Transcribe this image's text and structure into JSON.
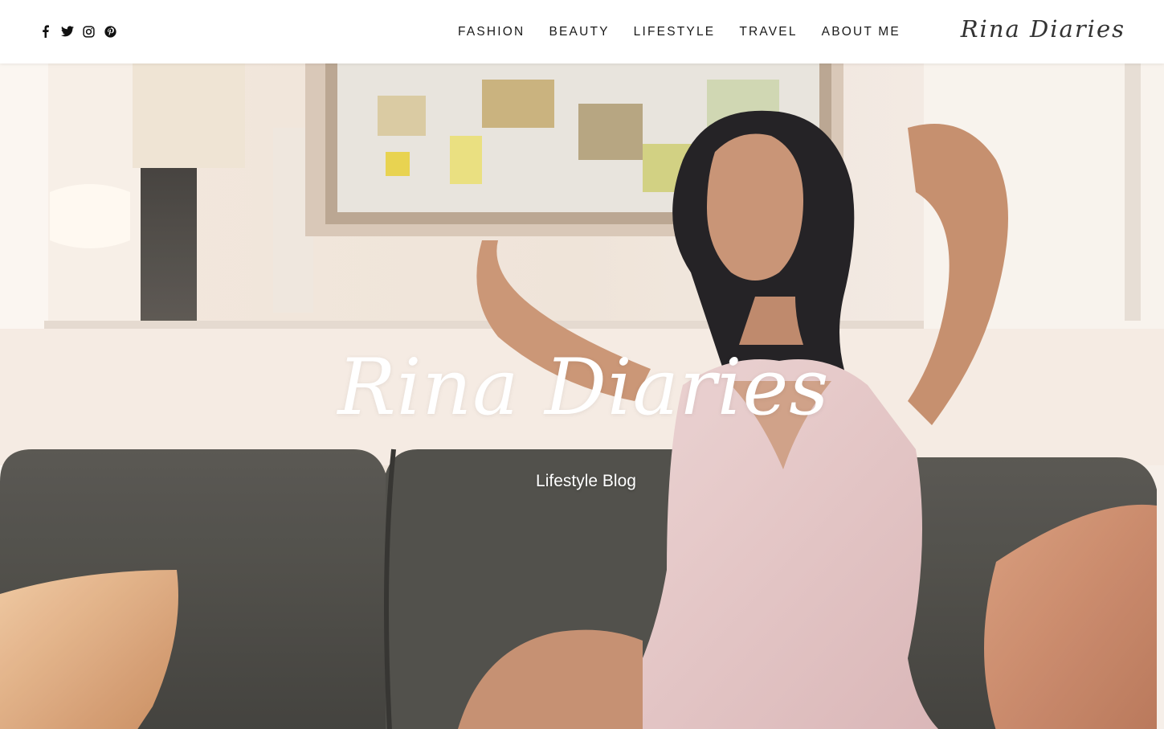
{
  "header": {
    "social": [
      {
        "name": "facebook-icon"
      },
      {
        "name": "twitter-icon"
      },
      {
        "name": "instagram-icon"
      },
      {
        "name": "pinterest-icon"
      }
    ],
    "nav": [
      {
        "label": "FASHION"
      },
      {
        "label": "BEAUTY"
      },
      {
        "label": "LIFESTYLE"
      },
      {
        "label": "TRAVEL"
      },
      {
        "label": "ABOUT ME"
      }
    ],
    "brand": "Rina Diaries"
  },
  "hero": {
    "title": "Rina Diaries",
    "subtitle": "Lifestyle Blog"
  },
  "colors": {
    "header_bg": "#ffffff",
    "nav_text": "#1a1a1a",
    "brand_text": "#333333",
    "hero_text": "#ffffff",
    "sofa": "#4a4a46",
    "dress": "#e7c9c9",
    "pillow": "#d9a078"
  }
}
